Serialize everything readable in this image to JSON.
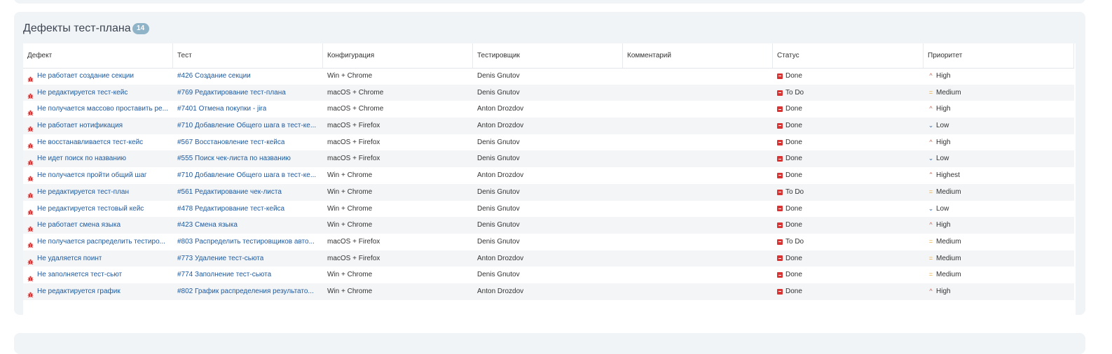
{
  "panel": {
    "title": "Дефекты тест-плана",
    "count": "14"
  },
  "columns": [
    "Дефект",
    "Тест",
    "Конфигурация",
    "Тестировщик",
    "Комментарий",
    "Статус",
    "Приоритет"
  ],
  "rows": [
    {
      "defect": "Не работает создание секции",
      "test": "#426 Создание секции",
      "config": "Win + Chrome",
      "tester": "Denis Gnutov",
      "comment": "",
      "status": "Done",
      "priority": "High"
    },
    {
      "defect": "Не редактируется тест-кейс",
      "test": "#769 Редактирование тест-плана",
      "config": "macOS + Chrome",
      "tester": "Denis Gnutov",
      "comment": "",
      "status": "To Do",
      "priority": "Medium"
    },
    {
      "defect": "Не получается массово проставить ре...",
      "test": "#7401 Отмена покупки - jira",
      "config": "macOS + Chrome",
      "tester": "Anton Drozdov",
      "comment": "",
      "status": "Done",
      "priority": "High"
    },
    {
      "defect": "Не работает нотификация",
      "test": "#710 Добавление Общего шага в тест-ке...",
      "config": "macOS + Firefox",
      "tester": "Anton Drozdov",
      "comment": "",
      "status": "Done",
      "priority": "Low"
    },
    {
      "defect": "Не восстанавливается тест-кейс",
      "test": "#567 Восстановление тест-кейса",
      "config": "macOS + Firefox",
      "tester": "Denis Gnutov",
      "comment": "",
      "status": "Done",
      "priority": "High"
    },
    {
      "defect": "Не идет поиск по названию",
      "test": "#555 Поиск чек-листа по названию",
      "config": "macOS + Firefox",
      "tester": "Denis Gnutov",
      "comment": "",
      "status": "Done",
      "priority": "Low"
    },
    {
      "defect": "Не получается пройти общий шаг",
      "test": "#710 Добавление Общего шага в тест-ке...",
      "config": "Win + Chrome",
      "tester": "Anton Drozdov",
      "comment": "",
      "status": "Done",
      "priority": "Highest"
    },
    {
      "defect": "Не редактируется тест-план",
      "test": "#561 Редактирование чек-листа",
      "config": "Win + Chrome",
      "tester": "Denis Gnutov",
      "comment": "",
      "status": "To Do",
      "priority": "Medium"
    },
    {
      "defect": "Не редактируется тестовый кейс",
      "test": "#478 Редактирование тест-кейса",
      "config": "Win + Chrome",
      "tester": "Denis Gnutov",
      "comment": "",
      "status": "Done",
      "priority": "Low"
    },
    {
      "defect": "Не работает смена языка",
      "test": "#423 Смена языка",
      "config": "Win + Chrome",
      "tester": "Denis Gnutov",
      "comment": "",
      "status": "Done",
      "priority": "High"
    },
    {
      "defect": "Не получается распределить тестиро...",
      "test": "#803 Распределить тестировщиков авто...",
      "config": "macOS + Firefox",
      "tester": "Denis Gnutov",
      "comment": "",
      "status": "To Do",
      "priority": "Medium"
    },
    {
      "defect": "Не удаляется поинт",
      "test": "#773 Удаление тест-сьюта",
      "config": "macOS + Firefox",
      "tester": "Anton Drozdov",
      "comment": "",
      "status": "Done",
      "priority": "Medium"
    },
    {
      "defect": "Не заполняется тест-сьют",
      "test": "#774 Заполнение тест-сьюта",
      "config": "Win + Chrome",
      "tester": "Denis Gnutov",
      "comment": "",
      "status": "Done",
      "priority": "Medium"
    },
    {
      "defect": "Не редактируется график",
      "test": "#802 График распределения результато...",
      "config": "Win + Chrome",
      "tester": "Anton Drozdov",
      "comment": "",
      "status": "Done",
      "priority": "High"
    }
  ],
  "colors": {
    "link": "#1e5aa0",
    "status": "#d93434",
    "high": "#e0503a",
    "medium": "#e9a32a",
    "low": "#2b66b8",
    "badge": "#8fb4c8"
  },
  "icons": {
    "defect": "bug-icon",
    "status": "status-icon",
    "high": "chevron-up-icon",
    "highest": "double-chevron-up-icon",
    "medium": "equals-icon",
    "low": "chevron-down-icon"
  }
}
